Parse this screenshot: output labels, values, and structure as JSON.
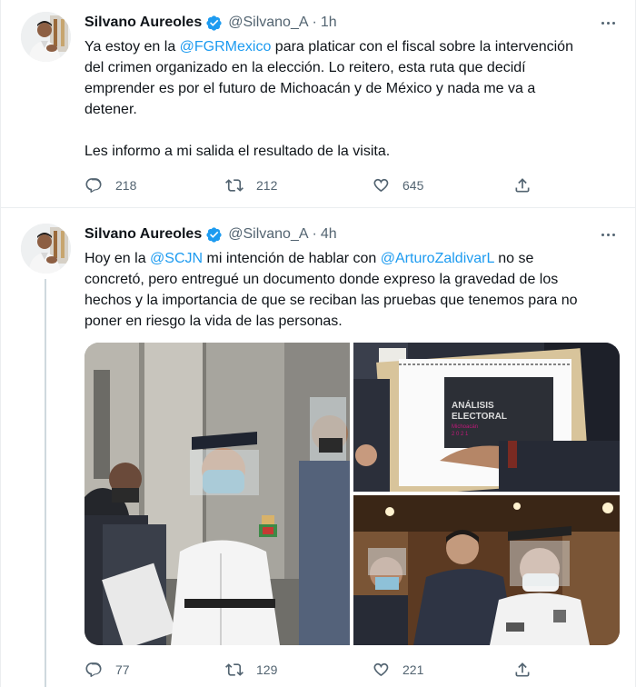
{
  "tweets": [
    {
      "author": {
        "name": "Silvano Aureoles",
        "handle": "@Silvano_A",
        "verified": true
      },
      "separator": "·",
      "time": "1h",
      "text": {
        "p1_l1_a": "Ya estoy en la ",
        "p1_l1_mention": "@FGRMexico",
        "p1_l1_b": " para platicar con el fiscal sobre la intervención",
        "p1_l2": "del crimen organizado en la elección. Lo reitero, esta ruta que decidí",
        "p1_l3": "emprender es por el futuro de Michoacán y de México y nada me va a",
        "p1_l4": "detener.",
        "p2_l1": "Les informo a mi salida el resultado de la visita."
      },
      "stats": {
        "replies": "218",
        "retweets": "212",
        "likes": "645"
      }
    },
    {
      "author": {
        "name": "Silvano Aureoles",
        "handle": "@Silvano_A",
        "verified": true
      },
      "separator": "·",
      "time": "4h",
      "text": {
        "l1_a": "Hoy en la ",
        "l1_mention1": "@SCJN",
        "l1_b": " mi intención de hablar con ",
        "l1_mention2": "@ArturoZaldivarL",
        "l1_c": " no se",
        "l2": "concretó, pero entregué un documento donde expreso la gravedad de los",
        "l3": "hechos y la importancia de que se reciban las pruebas que tenemos para no",
        "l4": "poner en riesgo la vida de las personas."
      },
      "media": {
        "document_title_1": "ANÁLISIS",
        "document_title_2": "ELECTORAL",
        "document_subtitle": "Michoacán",
        "document_year": "2 0 2 1"
      },
      "stats": {
        "replies": "77",
        "retweets": "129",
        "likes": "221"
      }
    }
  ],
  "colors": {
    "accent": "#1d9bf0",
    "text": "#0f1419",
    "secondary": "#536471",
    "border": "#ebeef0"
  },
  "icons": [
    "verified-badge-icon",
    "more-icon",
    "reply-icon",
    "retweet-icon",
    "like-icon",
    "share-icon"
  ]
}
